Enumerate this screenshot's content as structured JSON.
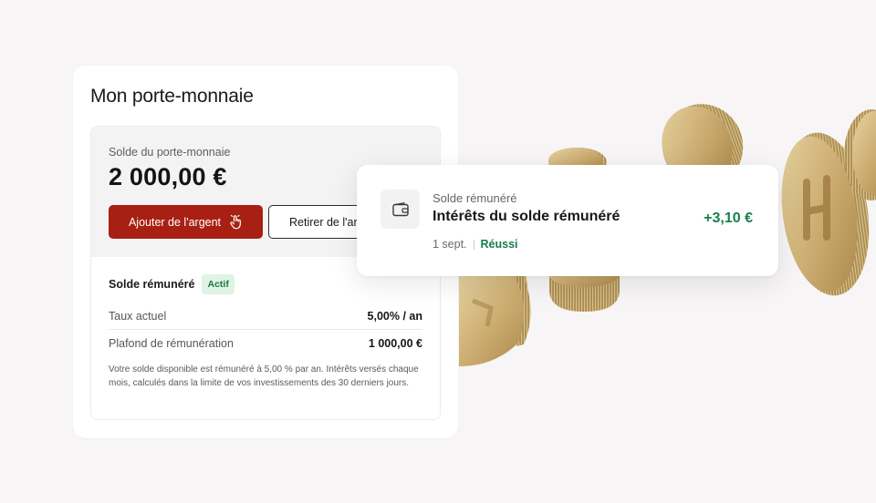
{
  "wallet": {
    "title": "Mon porte-monnaie",
    "balance_label": "Solde du porte-monnaie",
    "balance_amount": "2 000,00 €",
    "add_button": "Ajouter de l'argent",
    "withdraw_button": "Retirer de l'argent",
    "paid_balance": {
      "title": "Solde rémunéré",
      "badge": "Actif",
      "rows": [
        {
          "label": "Taux actuel",
          "value": "5,00% / an"
        },
        {
          "label": "Plafond de rémunération",
          "value": "1 000,00 €"
        }
      ],
      "disclaimer": "Votre solde disponible est rémunéré à 5,00 % par an. Intérêts versés chaque mois, calculés dans la limite de vos investissements des 30 derniers jours."
    }
  },
  "transaction": {
    "icon": "wallet-icon",
    "category": "Solde rémunéré",
    "title": "Intérêts du solde rémunéré",
    "amount": "+3,10 €",
    "date": "1 sept.",
    "status": "Réussi"
  },
  "colors": {
    "background": "#f7f5f6",
    "primary_button": "#a72013",
    "success": "#17804a",
    "badge_bg": "#dff4e4",
    "coin_gold": "#c9a86a"
  }
}
